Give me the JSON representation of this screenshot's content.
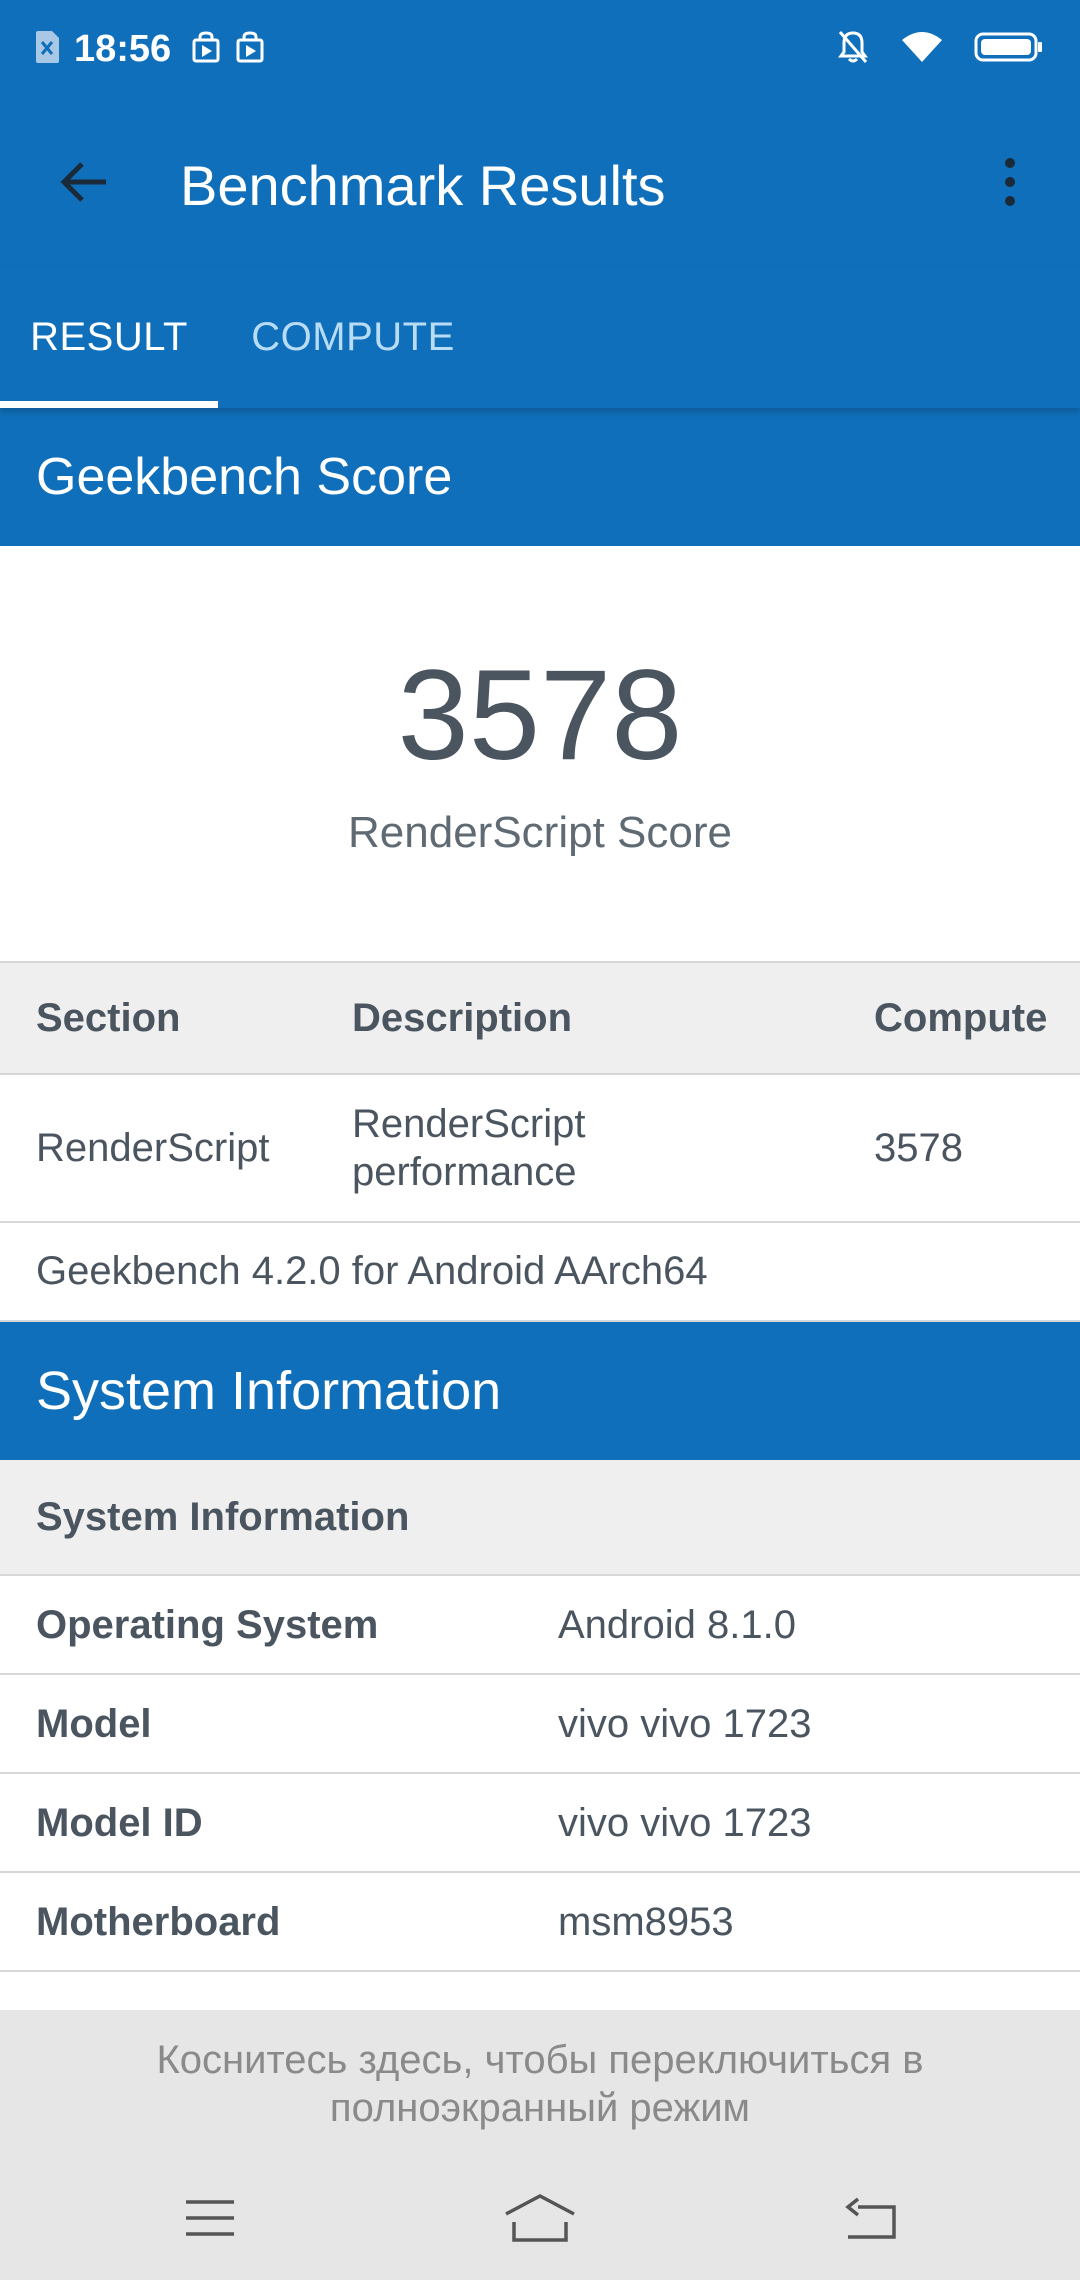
{
  "status_bar": {
    "time": "18:56",
    "icons": [
      "sim-card-icon",
      "bag-notification-icon",
      "bag-notification-icon",
      "bell-off-icon",
      "wifi-icon",
      "battery-icon"
    ]
  },
  "app_bar": {
    "title": "Benchmark Results",
    "back_icon": "arrow-left-icon",
    "more_icon": "more-vertical-icon"
  },
  "tabs": [
    {
      "label": "RESULT",
      "selected": true
    },
    {
      "label": "COMPUTE",
      "selected": false
    }
  ],
  "score_section": {
    "header": "Geekbench Score",
    "score": "3578",
    "score_label": "RenderScript Score"
  },
  "results_table": {
    "columns": [
      "Section",
      "Description",
      "Compute"
    ],
    "rows": [
      {
        "section": "RenderScript",
        "description_line1": "RenderScript",
        "description_line2": "performance",
        "compute": "3578"
      }
    ],
    "version": "Geekbench 4.2.0 for Android AArch64"
  },
  "system_info": {
    "header": "System Information",
    "subheader": "System Information",
    "rows": [
      {
        "key": "Operating System",
        "value": "Android 8.1.0"
      },
      {
        "key": "Model",
        "value": "vivo vivo 1723"
      },
      {
        "key": "Model ID",
        "value": "vivo vivo 1723"
      },
      {
        "key": "Motherboard",
        "value": "msm8953"
      }
    ]
  },
  "fullscreen_hint": {
    "line1": "Коснитесь здесь, чтобы переключиться в",
    "line2": "полноэкранный режим"
  },
  "nav_bar": {
    "icons": [
      "menu-icon",
      "home-icon",
      "back-icon"
    ]
  },
  "colors": {
    "primary": "#0f6fba",
    "tab_inactive": "#b9dcf5",
    "text": "#4a5560",
    "header_bg": "#efefef"
  }
}
